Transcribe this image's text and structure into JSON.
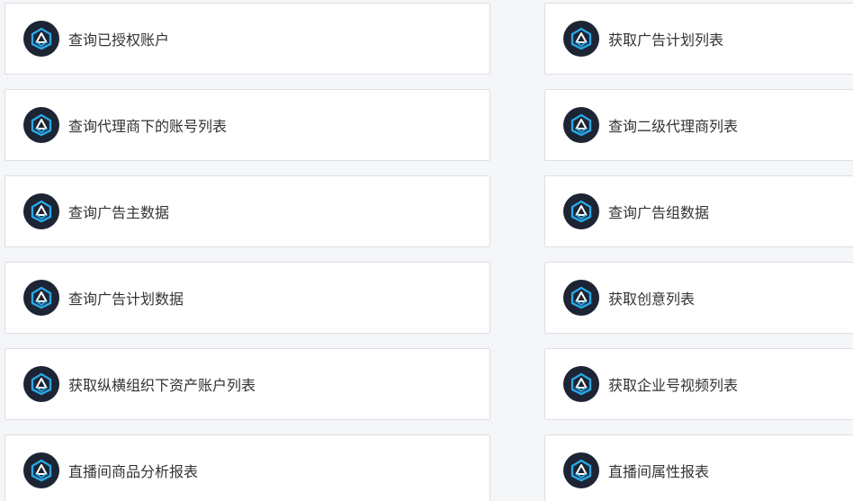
{
  "items": [
    {
      "left": "查询已授权账户",
      "right": "获取广告计划列表"
    },
    {
      "left": "查询代理商下的账号列表",
      "right": "查询二级代理商列表"
    },
    {
      "left": "查询广告主数据",
      "right": "查询广告组数据"
    },
    {
      "left": "查询广告计划数据",
      "right": "获取创意列表"
    },
    {
      "left": "获取纵横组织下资产账户列表",
      "right": "获取企业号视频列表"
    },
    {
      "left": "直播间商品分析报表",
      "right": "直播间属性报表"
    }
  ],
  "icon": "ocean-engine-logo-icon",
  "colors": {
    "icon_bg": "#1d2433",
    "icon_accent": "#2aa8e6",
    "card_border": "#dcdfe6",
    "text": "#333333"
  }
}
